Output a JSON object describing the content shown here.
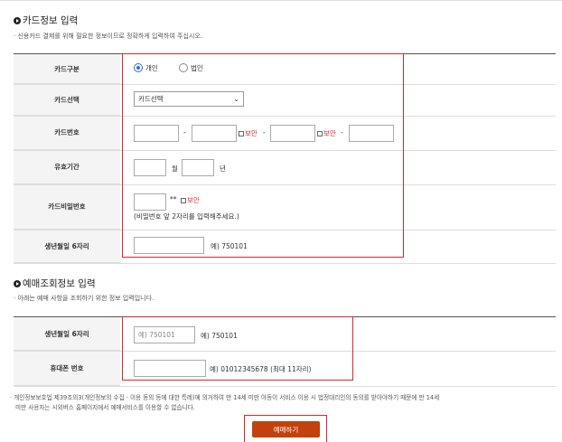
{
  "card_section": {
    "title": "카드정보 입력",
    "note": "· 신용카드 결제를 위해 필요한 정보이므로 정확하게 입력하여 주십시오.",
    "rows": {
      "card_type": {
        "label": "카드구분",
        "options": [
          "개인",
          "법인"
        ],
        "selected": "개인"
      },
      "card_select": {
        "label": "카드선택",
        "value": "카드선택"
      },
      "card_number": {
        "label": "카드번호",
        "dash": "-",
        "mask_label": "보안"
      },
      "expiry": {
        "label": "유효기간",
        "month_unit": "월",
        "year_unit": "년"
      },
      "password": {
        "label": "카드비밀번호",
        "stars": "**",
        "mask_label": "보안",
        "hint": "(비밀번호 앞 2자리를 입력해주세요.)"
      },
      "birth": {
        "label": "생년월일 6자리",
        "example": "예) 750101"
      }
    }
  },
  "inquiry_section": {
    "title": "예매조회정보 입력",
    "note": "· 아래는 예매 사항을 조회하기 위한 정보 입력입니다.",
    "rows": {
      "birth": {
        "label": "생년월일 6자리",
        "placeholder": "예) 750101",
        "example": "예) 750101"
      },
      "phone": {
        "label": "휴대폰 번호",
        "example": "예) 01012345678 (최대 11자리)"
      }
    }
  },
  "footer_note": {
    "line1": "· 개인정보보호법 제39조의3(개인정보의 수집 · 이용 동의 등에 대한 특례)에 의거하여 만 14세 미만 아동이 서비스 이용 시 법정대리인의 동의를 받아야하기 때문에 만 14세",
    "line2": "미만 사용자는 시외버스 홈페이지에서 예매서비스를 이용할 수 없습니다."
  },
  "submit": {
    "label": "예매하기"
  },
  "colors": {
    "accent": "#c2410c",
    "highlight": "#d9262c",
    "radio": "#2a6fdb"
  }
}
